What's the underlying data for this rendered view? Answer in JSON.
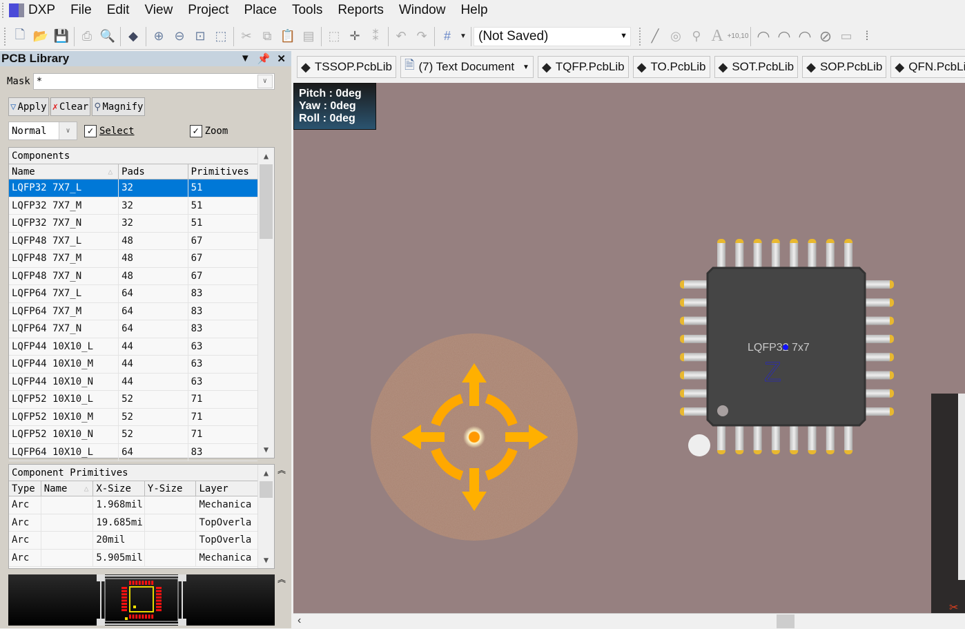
{
  "menubar": {
    "items": [
      "DXP",
      "File",
      "Edit",
      "View",
      "Project",
      "Place",
      "Tools",
      "Reports",
      "Window",
      "Help"
    ]
  },
  "toolbar": {
    "view_combo_value": "(Not Saved)",
    "icons_left": [
      "new-document-icon",
      "open-folder-icon",
      "save-icon",
      "print-icon",
      "print-preview-icon",
      "3d-view-icon",
      "zoom-in-icon",
      "zoom-out-icon",
      "zoom-fit-icon",
      "zoom-selection-icon",
      "cut-icon",
      "copy-icon",
      "paste-icon",
      "rubber-stamp-icon",
      "select-area-icon",
      "move-icon",
      "cross-select-icon",
      "undo-icon",
      "redo-icon",
      "grid-icon"
    ],
    "icons_right": [
      "line-icon",
      "pad-icon",
      "via-icon",
      "string-icon",
      "coordinate-icon",
      "arc-center-icon",
      "arc-edge-icon",
      "arc-any-icon",
      "full-circle-icon",
      "fill-icon",
      "array-paste-icon"
    ],
    "coord_label": "+10,10"
  },
  "panel": {
    "title": "PCB Library",
    "mask_label": "Mask",
    "mask_value": "*",
    "buttons": {
      "apply": "Apply",
      "clear": "Clear",
      "magnify": "Magnify"
    },
    "mode_value": "Normal",
    "select_label": "Select",
    "select_checked": true,
    "zoom_label": "Zoom",
    "zoom_checked": true,
    "components": {
      "header": "Components",
      "columns": [
        "Name",
        "Pads",
        "Primitives"
      ],
      "rows": [
        [
          "LQFP32 7X7_L",
          "32",
          "51"
        ],
        [
          "LQFP32 7X7_M",
          "32",
          "51"
        ],
        [
          "LQFP32 7X7_N",
          "32",
          "51"
        ],
        [
          "LQFP48 7X7_L",
          "48",
          "67"
        ],
        [
          "LQFP48 7X7_M",
          "48",
          "67"
        ],
        [
          "LQFP48 7X7_N",
          "48",
          "67"
        ],
        [
          "LQFP64 7X7_L",
          "64",
          "83"
        ],
        [
          "LQFP64 7X7_M",
          "64",
          "83"
        ],
        [
          "LQFP64 7X7_N",
          "64",
          "83"
        ],
        [
          "LQFP44 10X10_L",
          "44",
          "63"
        ],
        [
          "LQFP44 10X10_M",
          "44",
          "63"
        ],
        [
          "LQFP44 10X10_N",
          "44",
          "63"
        ],
        [
          "LQFP52 10X10_L",
          "52",
          "71"
        ],
        [
          "LQFP52 10X10_M",
          "52",
          "71"
        ],
        [
          "LQFP52 10X10_N",
          "52",
          "71"
        ],
        [
          "LQFP64 10X10_L",
          "64",
          "83"
        ]
      ],
      "selected_index": 0
    },
    "primitives": {
      "header": "Component Primitives",
      "columns": [
        "Type",
        "Name",
        "X-Size",
        "Y-Size",
        "Layer"
      ],
      "rows": [
        [
          "Arc",
          "",
          "1.968mil",
          "",
          "Mechanica"
        ],
        [
          "Arc",
          "",
          "19.685mi",
          "",
          "TopOverla"
        ],
        [
          "Arc",
          "",
          "20mil",
          "",
          "TopOverla"
        ],
        [
          "Arc",
          "",
          "5.905mil",
          "",
          "Mechanica"
        ]
      ]
    }
  },
  "tabs": [
    {
      "label": "TSSOP.PcbLib",
      "icon": "pcblib-icon"
    },
    {
      "label": "(7) Text Document",
      "icon": "text-document-icon",
      "dropdown": true
    },
    {
      "label": "TQFP.PcbLib",
      "icon": "pcblib-icon"
    },
    {
      "label": "TO.PcbLib",
      "icon": "pcblib-icon"
    },
    {
      "label": "SOT.PcbLib",
      "icon": "pcblib-icon"
    },
    {
      "label": "SOP.PcbLib",
      "icon": "pcblib-icon"
    },
    {
      "label": "QFN.PcbLib",
      "icon": "pcblib-icon"
    }
  ],
  "hud": {
    "pitch": "Pitch : 0deg",
    "yaw": "Yaw : 0deg",
    "roll": "Roll : 0deg"
  },
  "chip": {
    "label": "LQFP32 7x7",
    "pins_per_side": 8,
    "axis_label": "Z"
  },
  "colors": {
    "canvas": "#968080",
    "selection": "#0078d7",
    "pad_gold": "#e8b830",
    "navigator_orange": "#ffb000"
  }
}
